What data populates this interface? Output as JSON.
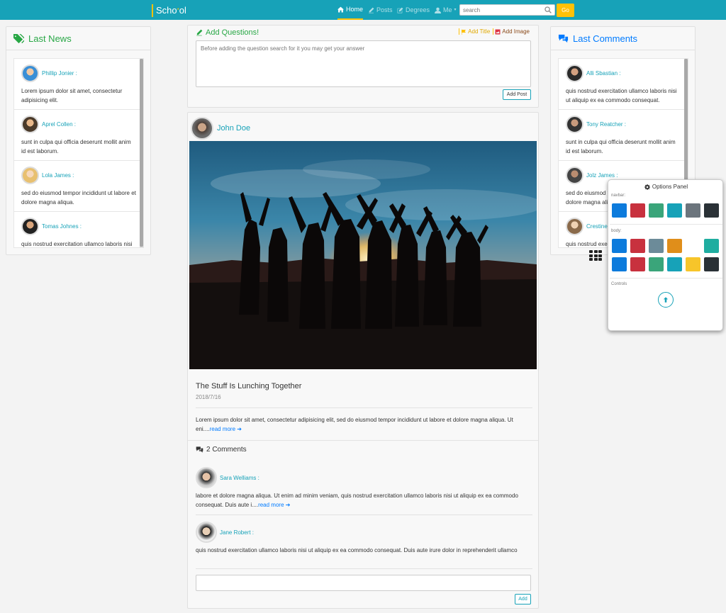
{
  "navbar": {
    "brand_pre": "Scho",
    "brand_star": "*",
    "brand_post": "ol",
    "items": [
      {
        "label": "Home",
        "icon": "home-icon",
        "active": true
      },
      {
        "label": "Posts",
        "icon": "pencil-icon",
        "active": false
      },
      {
        "label": "Degrees",
        "icon": "edit-icon",
        "active": false
      },
      {
        "label": "Me",
        "icon": "user-icon",
        "active": false
      }
    ],
    "search_placeholder": "search",
    "search_button": "Go",
    "color": "#17a2b8",
    "accent": "#ffc107"
  },
  "last_news": {
    "title": "Last News",
    "items": [
      {
        "name": "Phillip Jonier :",
        "text": "Lorem ipsum dolor sit amet, consectetur adipisicing elit."
      },
      {
        "name": "Aprel Collen :",
        "text": "sunt in culpa qui officia deserunt mollit anim id est laborum."
      },
      {
        "name": "Lola James :",
        "text": "sed do eiusmod tempor incididunt ut labore et dolore magna aliqua."
      },
      {
        "name": "Tomas Johnes :",
        "text": "quis nostrud exercitation ullamco laboris nisi ut aliquip ex ea commodo consequat."
      }
    ]
  },
  "add_question": {
    "title": "Add Questions!",
    "add_title": "Add Title",
    "add_image": "Add Image",
    "placeholder": "Before adding the question search for it you may get your answer",
    "submit": "Add Post"
  },
  "post": {
    "author": "John Doe",
    "title": "The Stuff Is Lunching Together",
    "date": "2018/7/16",
    "body": "Lorem ipsum dolor sit amet, consectetur adipisicing elit, sed do eiusmod tempor incididunt ut labore et dolore magna aliqua. Ut eni....",
    "read_more": "read more",
    "comments_title": "2 Comments",
    "comments": [
      {
        "name": "Sara Welliams :",
        "text": "labore et dolore magna aliqua. Ut enim ad minim veniam, quis nostrud exercitation ullamco laboris nisi ut aliquip ex ea commodo consequat. Duis aute i....",
        "read_more": "read more"
      },
      {
        "name": "Jane Robert :",
        "text": "quis nostrud exercitation ullamco laboris nisi ut aliquip ex ea commodo consequat. Duis aute irure dolor in reprehenderit ullamco",
        "read_more": ""
      }
    ],
    "add_button": "Add"
  },
  "last_comments": {
    "title": "Last Comments",
    "items": [
      {
        "name": "Alli Sbastian :",
        "text": "quis nostrud exercitation ullamco laboris nisi ut aliquip ex ea commodo consequat."
      },
      {
        "name": "Tony Reatcher :",
        "text": "sunt in culpa qui officia deserunt mollit anim id est laborum."
      },
      {
        "name": "Jolz James :",
        "text": "sed do eiusmod tempor incididunt ut labore et dolore magna aliqua."
      },
      {
        "name": "Crestine",
        "text": "quis nostrud exercitation ullamco laboris nisi ut aliquip ex ea commodo consequat."
      }
    ]
  },
  "options_panel": {
    "title": "Options Panel",
    "navbar_label": "navbar:",
    "body_label": "body:",
    "controls_label": "Controls",
    "navbar_colors": [
      "#0d7bdc",
      "#c8313e",
      "#3aa57a",
      "#17a2b8",
      "#6c757d",
      "#2a3136"
    ],
    "body_colors_row1": [
      "#0d7bdc",
      "#c8313e",
      "#6c8b99",
      "#e08e1a",
      "#ffffff",
      "#1fada0"
    ],
    "body_colors_row2": [
      "#0d7bdc",
      "#c8313e",
      "#3aa57a",
      "#17a2b8",
      "#f7c52a",
      "#2a3136"
    ]
  }
}
